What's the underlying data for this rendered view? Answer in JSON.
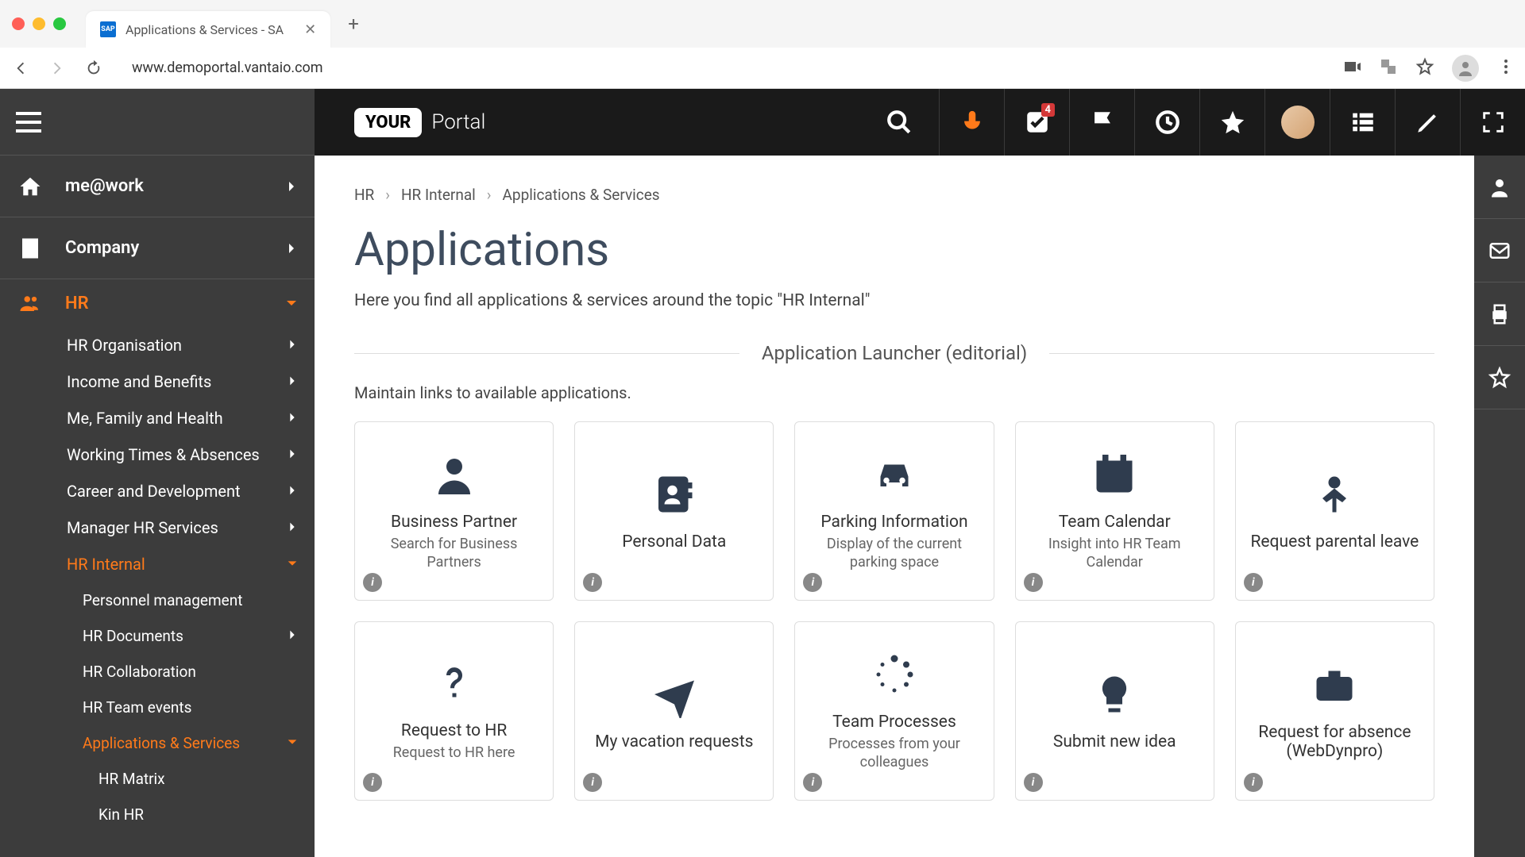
{
  "browser": {
    "tab_title": "Applications & Services - SA",
    "url": "www.demoportal.vantaio.com",
    "favicon_text": "SAP"
  },
  "logo": {
    "boxed": "YOUR",
    "text": "Portal"
  },
  "topbar": {
    "notification_count": "4"
  },
  "sidebar": {
    "me_at_work": "me@work",
    "company": "Company",
    "hr": "HR",
    "hr_organisation": "HR Organisation",
    "income_benefits": "Income and Benefits",
    "me_family_health": "Me, Family and Health",
    "working_times": "Working Times & Absences",
    "career_dev": "Career and Development",
    "manager_hr": "Manager HR Services",
    "hr_internal": "HR Internal",
    "personnel_mgmt": "Personnel management",
    "hr_documents": "HR Documents",
    "hr_collab": "HR Collaboration",
    "hr_team_events": "HR Team events",
    "apps_services": "Applications & Services",
    "hr_matrix": "HR Matrix",
    "kin_hr": "Kin HR"
  },
  "breadcrumb": {
    "a": "HR",
    "b": "HR Internal",
    "c": "Applications & Services"
  },
  "page": {
    "title": "Applications",
    "subtitle": "Here you find all applications & services around the topic \"HR Internal\"",
    "launcher_heading": "Application Launcher (editorial)",
    "maintain_text": "Maintain links to available applications."
  },
  "cards": {
    "c0": {
      "title": "Business Partner",
      "desc": "Search for Business Partners"
    },
    "c1": {
      "title": "Personal Data",
      "desc": ""
    },
    "c2": {
      "title": "Parking Information",
      "desc": "Display of the current parking space"
    },
    "c3": {
      "title": "Team Calendar",
      "desc": "Insight into HR Team Calendar"
    },
    "c4": {
      "title": "Request parental leave",
      "desc": ""
    },
    "c5": {
      "title": "Request to HR",
      "desc": "Request to HR here"
    },
    "c6": {
      "title": "My vacation requests",
      "desc": ""
    },
    "c7": {
      "title": "Team Processes",
      "desc": "Processes from your colleagues"
    },
    "c8": {
      "title": "Submit new idea",
      "desc": ""
    },
    "c9": {
      "title": "Request for absence (WebDynpro)",
      "desc": ""
    }
  }
}
